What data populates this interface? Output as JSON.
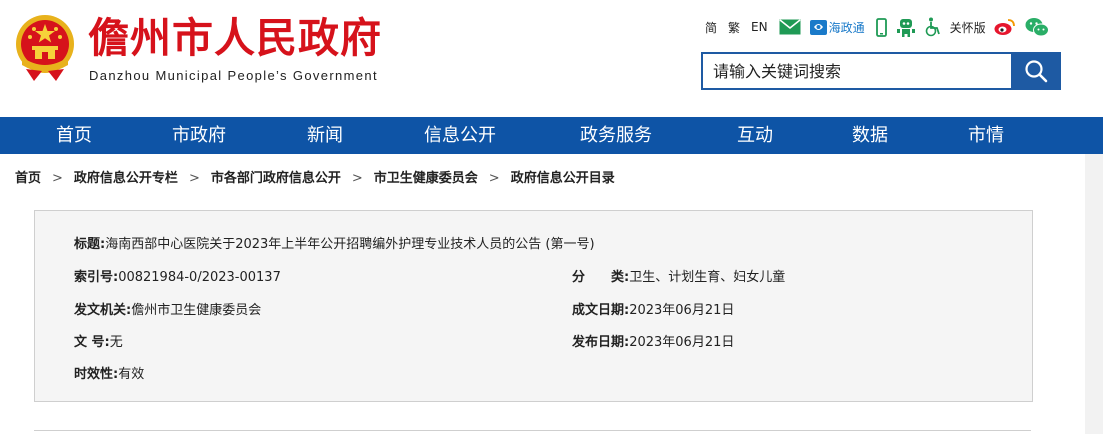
{
  "header": {
    "site_title": "儋州市人民政府",
    "site_subtitle": "Danzhou Municipal People’s Government",
    "toolbar": {
      "simplified": "简",
      "traditional": "繁",
      "english": "EN",
      "hzt_label": "海政通",
      "care_label": "关怀版"
    },
    "search": {
      "placeholder": "请输入关键词搜索"
    }
  },
  "nav": {
    "items": [
      "首页",
      "市政府",
      "新闻",
      "信息公开",
      "政务服务",
      "互动",
      "数据",
      "市情"
    ]
  },
  "breadcrumb": {
    "items": [
      "首页",
      "政府信息公开专栏",
      "市各部门政府信息公开",
      "市卫生健康委员会",
      "政府信息公开目录"
    ],
    "separator": ">"
  },
  "info": {
    "title_label": "标题:",
    "title_value": "海南西部中心医院关于2023年上半年公开招聘编外护理专业技术人员的公告 (第一号)",
    "index_label": "索引号:",
    "index_value": "00821984-0/2023-00137",
    "category_label": "分　　类:",
    "category_value": "卫生、计划生育、妇女儿童",
    "issuer_label": "发文机关:",
    "issuer_value": "儋州市卫生健康委员会",
    "created_label": "成文日期:",
    "created_value": "2023年06月21日",
    "docno_label": "文 号:",
    "docno_value": "无",
    "published_label": "发布日期:",
    "published_value": "2023年06月21日",
    "validity_label": "时效性:",
    "validity_value": "有效"
  },
  "colors": {
    "brand_red": "#d6121b",
    "nav_blue": "#0e54a6",
    "search_blue": "#1e5aa3",
    "wechat_green": "#2aae67",
    "mobile_green": "#1f9a55"
  }
}
